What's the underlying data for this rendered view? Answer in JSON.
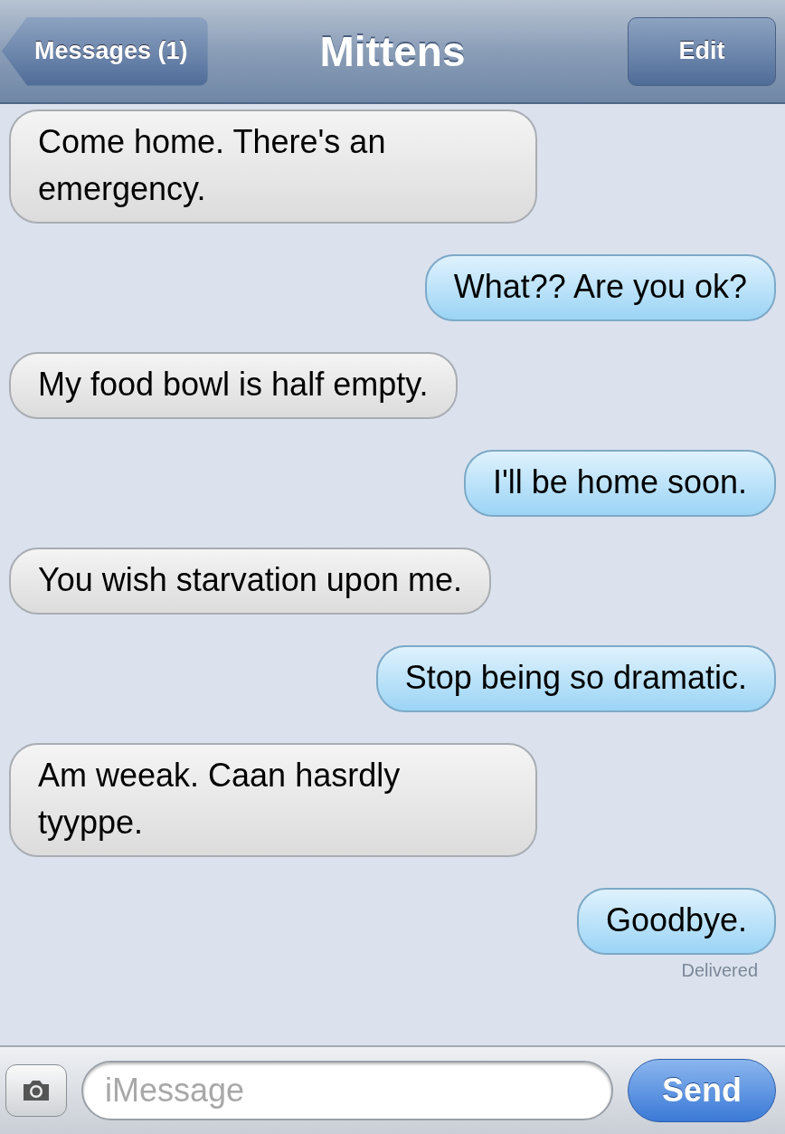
{
  "nav_bar": {
    "back_button": "Messages (1)",
    "title": "Mittens",
    "edit_button": "Edit"
  },
  "messages": [
    {
      "kind": "received",
      "text": "Come home. There's an emergency."
    },
    {
      "kind": "sent",
      "text": "What?? Are you ok?"
    },
    {
      "kind": "received",
      "text": "My food bowl is half empty."
    },
    {
      "kind": "sent",
      "text": "I'll be home soon."
    },
    {
      "kind": "received",
      "text": "You wish starvation upon me."
    },
    {
      "kind": "sent",
      "text": "Stop being so dramatic."
    },
    {
      "kind": "received",
      "text": "Am weeak. Caan hasrdly tyyppe."
    },
    {
      "kind": "sent",
      "text": "Goodbye."
    }
  ],
  "status": "Delivered",
  "compose_bar": {
    "placeholder": "iMessage",
    "send_button": "Send"
  }
}
